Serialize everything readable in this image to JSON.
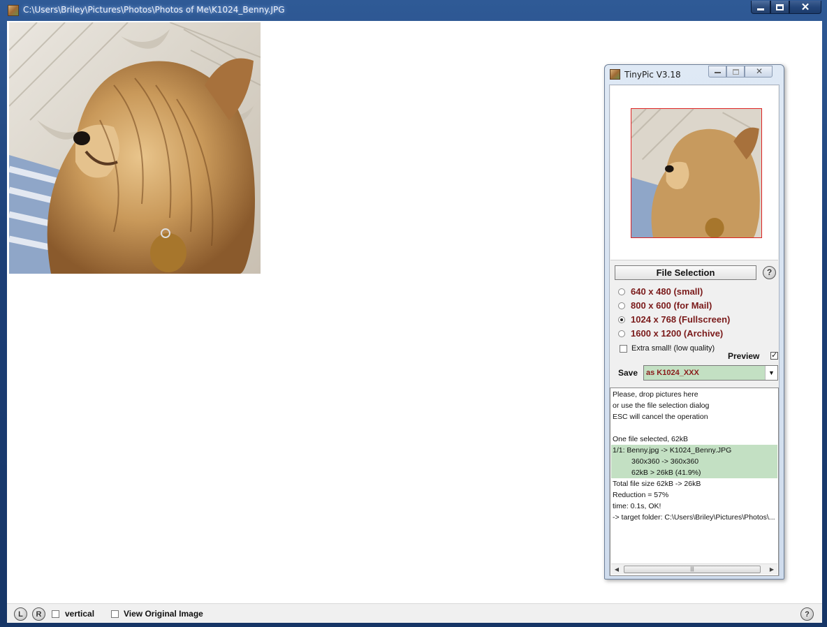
{
  "main_window": {
    "title": "C:\\Users\\Briley\\Pictures\\Photos\\Photos of Me\\K1024_Benny.JPG",
    "close_glyph": "✕"
  },
  "photo": {
    "subject": "Yorkshire terrier dog on striped blanket"
  },
  "bottom_bar": {
    "l_button": "L",
    "r_button": "R",
    "vertical_label": "vertical",
    "vertical_checked": false,
    "view_original_label": "View Original Image",
    "view_original_checked": false,
    "help_glyph": "?"
  },
  "tinypic": {
    "title": "TinyPic V3.18",
    "close_glyph": "✕",
    "file_selection_label": "File Selection",
    "help_glyph": "?",
    "size_options": [
      {
        "label": "640 x 480 (small)",
        "selected": false
      },
      {
        "label": "800 x 600 (for Mail)",
        "selected": false
      },
      {
        "label": "1024 x 768 (Fullscreen)",
        "selected": true
      },
      {
        "label": "1600 x 1200 (Archive)",
        "selected": false
      }
    ],
    "extra_small_label": "Extra small! (low quality)",
    "extra_small_checked": false,
    "preview_label": "Preview",
    "preview_checked": true,
    "preview_check_glyph": "✓",
    "save_label": "Save",
    "save_value": "as K1024_XXX",
    "save_arrow_glyph": "▼",
    "log": {
      "lines": [
        {
          "text": "Please, drop pictures here"
        },
        {
          "text": "or use the file selection dialog"
        },
        {
          "text": "ESC will cancel the operation"
        },
        {
          "text": ""
        },
        {
          "text": "One file selected, 62kB"
        },
        {
          "text": "1/1: Benny.jpg -> K1024_Benny.JPG"
        },
        {
          "text": "360x360 -> 360x360"
        },
        {
          "text": "62kB > 26kB (41.9%)"
        },
        {
          "text": "Total file size 62kB -> 26kB"
        },
        {
          "text": "Reduction = 57%"
        },
        {
          "text": "time: 0.1s, OK!"
        },
        {
          "text": "-> target folder: C:\\Users\\Briley\\Pictures\\Photos\\..."
        }
      ]
    },
    "scroll_left_glyph": "◀",
    "scroll_right_glyph": "▶",
    "scroll_thumb_glyph": "|||"
  },
  "colors": {
    "highlight_green": "#c3e0c3",
    "option_text": "#7a1a1a",
    "preview_border": "#dd2222"
  }
}
